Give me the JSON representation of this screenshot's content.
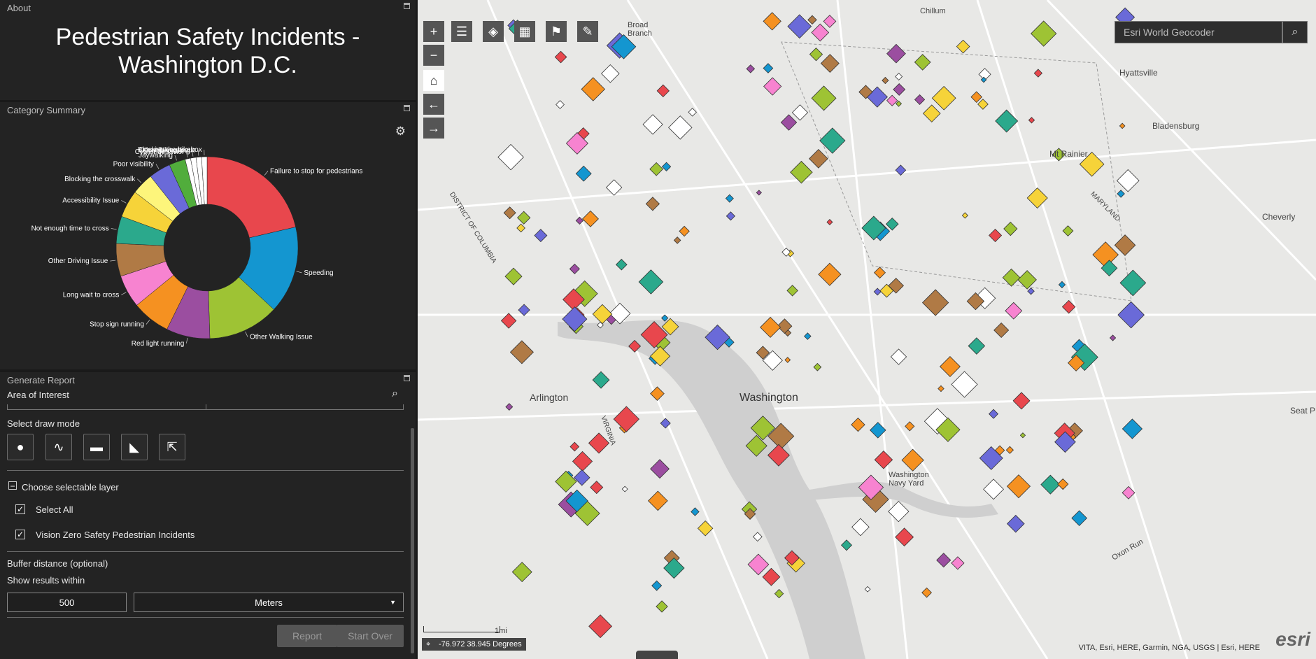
{
  "about": {
    "panel_title": "About",
    "title_line1": "Pedestrian Safety Incidents -",
    "title_line2": "Washington D.C."
  },
  "summary": {
    "panel_title": "Category Summary"
  },
  "chart_data": {
    "type": "pie",
    "categories": [
      "Failure to stop for pedestrians",
      "Speeding",
      "Other Walking Issue",
      "Red light running",
      "Stop sign running",
      "Long wait to cross",
      "Other Driving Issue",
      "Not enough time to cross",
      "Accessibility Issue",
      "Blocking the crosswalk",
      "Poor visibility",
      "Jaywalking",
      "Cyclist behavior",
      "Double parking",
      "Other Biking Issue",
      "Blocking the bikebox"
    ],
    "values": [
      22,
      16,
      13,
      8,
      7,
      6,
      6,
      5,
      5,
      4,
      4,
      3,
      1,
      1,
      1,
      1
    ],
    "colors": [
      "#e8474d",
      "#1496d0",
      "#9ec334",
      "#9b4ea0",
      "#f59121",
      "#f783d0",
      "#b07a45",
      "#2ba98c",
      "#f6d339",
      "#fdf57b",
      "#6a6ad8",
      "#51ad3c",
      "#ffffff",
      "#ffffff",
      "#ffffff",
      "#ffffff"
    ]
  },
  "report": {
    "panel_title": "Generate Report",
    "area_label": "Area of Interest",
    "draw_mode_label": "Select draw mode",
    "choose_layer_label": "Choose selectable layer",
    "select_all_label": "Select All",
    "layer_label": "Vision Zero Safety Pedestrian Incidents",
    "buffer_label": "Buffer distance (optional)",
    "show_within_label": "Show results within",
    "distance_value": "500",
    "unit_value": "Meters",
    "report_button": "Report",
    "start_over_button": "Start Over"
  },
  "map": {
    "search_placeholder": "Esri World Geocoder",
    "coords": "-76.972 38.945 Degrees",
    "scale_label": "1mi",
    "attribution": "VITA, Esri, HERE, Garmin, NGA, USGS | Esri, HERE",
    "powered_by": "esri",
    "places": {
      "washington": "Washington",
      "arlington": "Arlington",
      "hyattsville": "Hyattsville",
      "bladensburg": "Bladensburg",
      "mt_rainier": "Mt Rainier",
      "cheverly": "Cheverly",
      "navy_yard": "Washington Navy Yard",
      "seat_pleasant": "Seat P",
      "maryland": "MARYLAND",
      "dc": "DISTRICT OF COLUMBIA",
      "virginia": "VIRGINIA",
      "broad_branch": "Broad Branch",
      "oxon_run": "Oxon Run",
      "chillum": "Chillum"
    }
  }
}
